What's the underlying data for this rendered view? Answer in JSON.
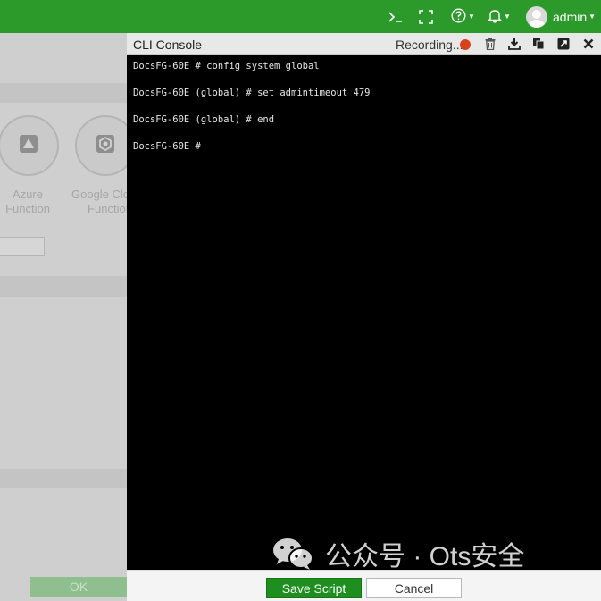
{
  "topbar": {
    "bg_color": "#2b9a2b",
    "icons": [
      "cli-prompt-icon",
      "fullscreen-icon",
      "help-icon",
      "bell-icon"
    ],
    "user": "admin"
  },
  "background_page": {
    "cards": [
      {
        "label": "Azure\nFunction",
        "icon": "azure-icon"
      },
      {
        "label": "Google Cloud\nFunction",
        "icon": "google-cloud-icon"
      }
    ],
    "ok_label": "OK"
  },
  "console": {
    "title": "CLI Console",
    "recording_label": "Recording...",
    "recording_color": "#d9411c",
    "actions": [
      "trash-icon",
      "download-icon",
      "copy-icon",
      "expand-icon",
      "close-icon"
    ],
    "lines": [
      "DocsFG-60E # config system global",
      "DocsFG-60E (global) # set admintimeout 479",
      "DocsFG-60E (global) # end",
      "DocsFG-60E #"
    ],
    "save_label": "Save Script",
    "cancel_label": "Cancel"
  },
  "watermark": {
    "text": "公众号 · Ots安全"
  }
}
